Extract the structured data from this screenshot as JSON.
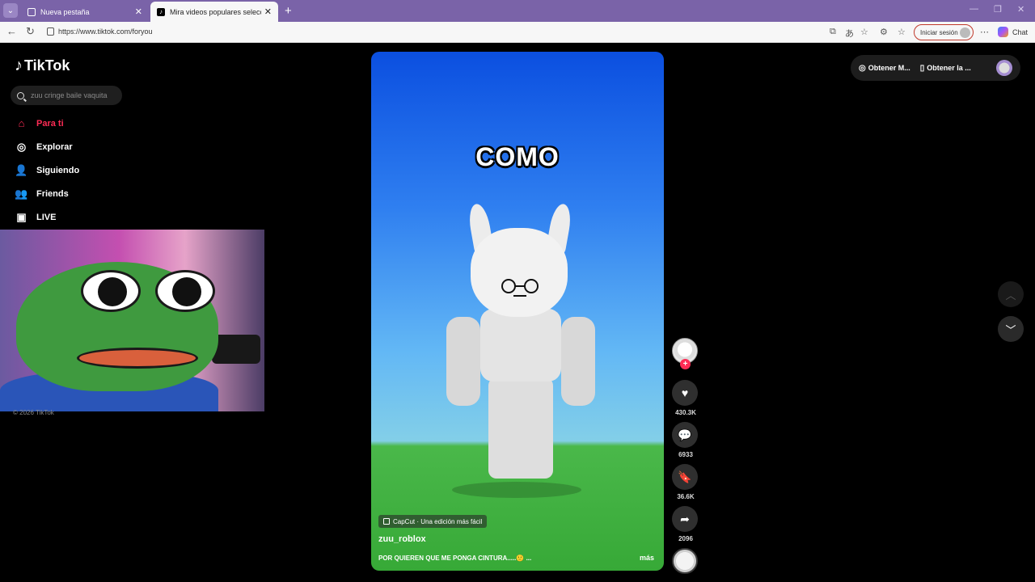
{
  "browser": {
    "tabs": [
      {
        "label": "Nueva pestaña",
        "active": false
      },
      {
        "label": "Mira videos populares seleccionados",
        "active": true
      }
    ],
    "url": "https://www.tiktok.com/foryou",
    "signin_label": "Iniciar sesión",
    "chat_label": "Chat"
  },
  "sidebar": {
    "logo": "TikTok",
    "search_placeholder": "zuu cringe baile vaquita",
    "items": [
      {
        "label": "Para ti",
        "icon": "home-icon",
        "active": true
      },
      {
        "label": "Explorar",
        "icon": "compass-icon",
        "active": false
      },
      {
        "label": "Siguiendo",
        "icon": "user-follow-icon",
        "active": false
      },
      {
        "label": "Friends",
        "icon": "friends-icon",
        "active": false
      },
      {
        "label": "LIVE",
        "icon": "live-tv-icon",
        "active": false
      }
    ],
    "copyright": "© 2026 TikTok"
  },
  "video": {
    "caption_word": "COMO",
    "effect_label": "CapCut · Una edición más fácil",
    "username": "zuu_roblox",
    "description": "POR QUIEREN QUE ME PONGA CINTURA.....🙂 ...",
    "more_label": "más"
  },
  "actions": {
    "likes": "430.3K",
    "comments": "6933",
    "saves": "36.6K",
    "shares": "2096"
  },
  "header": {
    "get_coins": "Obtener M...",
    "get_app": "Obtener la ..."
  }
}
